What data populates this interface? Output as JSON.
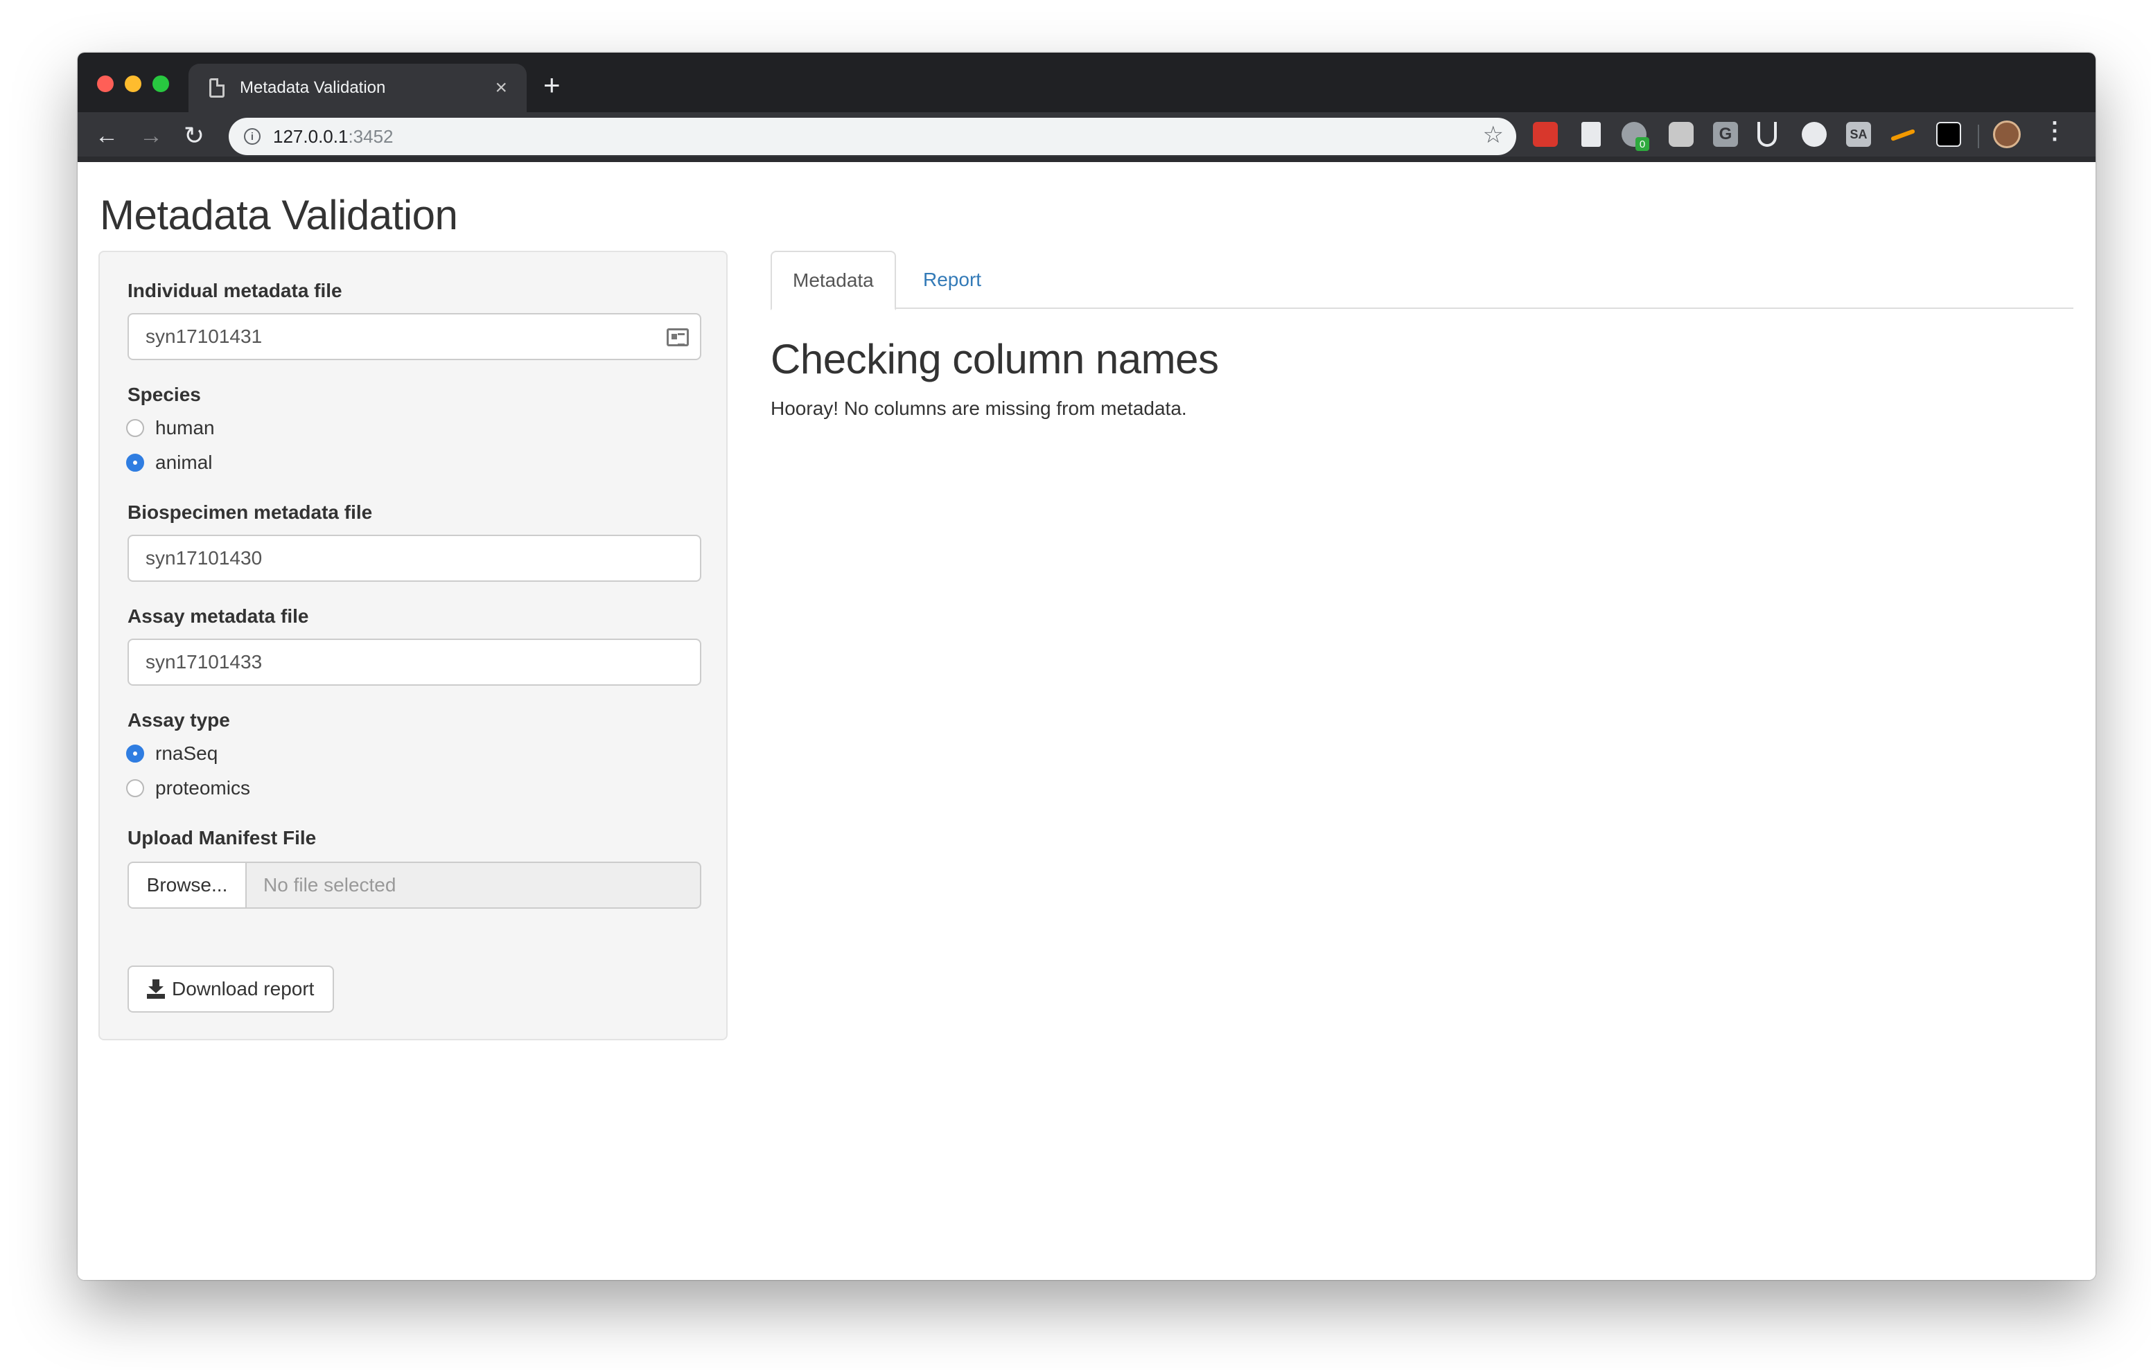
{
  "browser": {
    "tab_title": "Metadata Validation",
    "tab_close": "×",
    "new_tab": "+",
    "url_host": "127.0.0.1",
    "url_port": ":3452",
    "ext_badge": "0",
    "ext_g": "G",
    "ext_sa": "SA",
    "menu": "⋮"
  },
  "page": {
    "title": "Metadata Validation"
  },
  "sidebar": {
    "individual": {
      "label": "Individual metadata file",
      "value": "syn17101431"
    },
    "species": {
      "label": "Species",
      "options": [
        "human",
        "animal"
      ],
      "selected": "animal"
    },
    "biospecimen": {
      "label": "Biospecimen metadata file",
      "value": "syn17101430"
    },
    "assay": {
      "label": "Assay metadata file",
      "value": "syn17101433"
    },
    "assay_type": {
      "label": "Assay type",
      "options": [
        "rnaSeq",
        "proteomics"
      ],
      "selected": "rnaSeq"
    },
    "manifest": {
      "label": "Upload Manifest File",
      "browse_label": "Browse...",
      "placeholder": "No file selected"
    },
    "download_label": "Download report"
  },
  "main": {
    "tabs": [
      {
        "label": "Metadata",
        "active": true
      },
      {
        "label": "Report",
        "active": false
      }
    ],
    "heading": "Checking column names",
    "message": "Hooray! No columns are missing from metadata."
  }
}
